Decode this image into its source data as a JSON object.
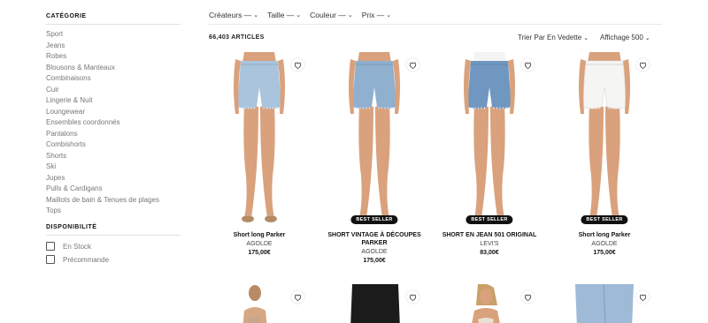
{
  "sidebar": {
    "category_title": "CATÉGORIE",
    "categories": [
      "Sport",
      "Jeans",
      "Robes",
      "Blousons & Manteaux",
      "Combinaisons",
      "Cuir",
      "Lingerie & Nuit",
      "Loungewear",
      "Ensembles coordonnés",
      "Pantalons",
      "Combishorts",
      "Shorts",
      "Ski",
      "Jupes",
      "Pulls & Cardigans",
      "Maillots de bain & Tenues de plages",
      "Tops"
    ],
    "availability_title": "DISPONIBILITÉ",
    "availability": [
      {
        "label": "En Stock",
        "checked": false
      },
      {
        "label": "Précommande",
        "checked": false
      }
    ]
  },
  "filters": [
    "Créateurs —",
    "Taille —",
    "Couleur —",
    "Prix —"
  ],
  "toolbar": {
    "count": "66,403 ARTICLES",
    "sort": "Trier Par En Vedette",
    "display": "Affichage 500"
  },
  "products": [
    {
      "name": "Short long Parker",
      "brand": "AGOLDE",
      "price": "175,00€",
      "badge": "",
      "denim": "#a9c4dc",
      "wash": "light"
    },
    {
      "name": "SHORT VINTAGE À DÉCOUPES PARKER",
      "brand": "AGOLDE",
      "price": "175,00€",
      "badge": "BEST SELLER",
      "denim": "#8fb0cf",
      "wash": "light"
    },
    {
      "name": "SHORT EN JEAN 501 ORIGINAL",
      "brand": "LEVI'S",
      "price": "83,00€",
      "badge": "BEST SELLER",
      "denim": "#6f97c0",
      "wash": "medium"
    },
    {
      "name": "Short long Parker",
      "brand": "AGOLDE",
      "price": "175,00€",
      "badge": "BEST SELLER",
      "denim": "#f5f5f3",
      "wash": "white"
    }
  ],
  "colors": {
    "skin": "#d9a17c",
    "badge": "#111111"
  }
}
